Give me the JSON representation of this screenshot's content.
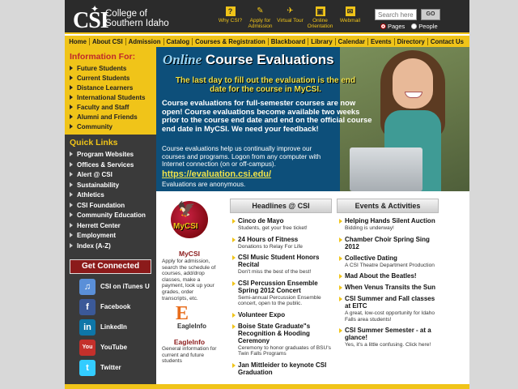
{
  "header": {
    "logo_text": "CSI",
    "college_name_line1": "College of",
    "college_name_line2": "Southern Idaho",
    "toolbar": [
      {
        "icon": "question-icon",
        "glyph": "?",
        "label": "Why CSI?"
      },
      {
        "icon": "pencil-icon",
        "glyph": "✎",
        "label": "Apply for Admission"
      },
      {
        "icon": "eagle-icon",
        "glyph": "✈",
        "label": "Virtual Tour"
      },
      {
        "icon": "monitor-icon",
        "glyph": "▣",
        "label": "Online Orientation"
      },
      {
        "icon": "mail-icon",
        "glyph": "✉",
        "label": "Webmail"
      }
    ],
    "search_placeholder": "Search here",
    "go_label": "GO",
    "radio_pages": "Pages",
    "radio_people": "People"
  },
  "nav": [
    "Home",
    "About CSI",
    "Admission",
    "Catalog",
    "Courses & Registration",
    "Blackboard",
    "Library",
    "Calendar",
    "Events",
    "Directory",
    "Contact Us"
  ],
  "info": {
    "title": "Information For:",
    "items": [
      "Future Students",
      "Current Students",
      "Distance Learners",
      "International Students",
      "Faculty and Staff",
      "Alumni and Friends",
      "Community"
    ]
  },
  "quick": {
    "title": "Quick Links",
    "items": [
      "Program Websites",
      "Offices & Services",
      "Alert @ CSI",
      "Sustainability",
      "Athletics",
      "CSI Foundation",
      "Community Education",
      "Herrett Center",
      "Employment",
      "Index (A-Z)"
    ]
  },
  "connect": {
    "title": "Get Connected",
    "items": [
      {
        "icon": "itunes-icon",
        "glyph": "♫",
        "color": "#5a8fd8",
        "label": "CSI on iTunes U"
      },
      {
        "icon": "facebook-icon",
        "glyph": "f",
        "color": "#3b5998",
        "label": "Facebook"
      },
      {
        "icon": "linkedin-icon",
        "glyph": "in",
        "color": "#0e76a8",
        "label": "LinkedIn"
      },
      {
        "icon": "youtube-icon",
        "glyph": "You",
        "color": "#c4302b",
        "label": "YouTube"
      },
      {
        "icon": "twitter-icon",
        "glyph": "t",
        "color": "#33ccff",
        "label": "Twitter"
      }
    ]
  },
  "banner": {
    "title_italic": "Online",
    "title_rest": "Course Evaluations",
    "subtitle": "The last day to fill out the evaluation is the end date for the course in MyCSI.",
    "body": "Course evaluations for full-semester courses are now open! Course evaluations become available two weeks prior to the course end date and end on the official course end date in MyCSI. We need your feedback!",
    "small": "Course evaluations help us continually improve our courses and programs. Logon from any computer with Internet connection (on or off-campus).",
    "url": "https://evaluation.csi.edu/",
    "anon": "Evaluations are anonymous."
  },
  "apps": {
    "mycsi_logo_text": "MyCSI",
    "mycsi_name": "MyCSI",
    "mycsi_desc": "Apply for admission, search the schedule of courses, add/drop classes, make a payment, look up your grades, order transcripts, etc.",
    "eagle_logo_e": "E",
    "eagle_logo_word": "EagleInfo",
    "eagle_name": "EagleInfo",
    "eagle_desc": "General information for current and future students"
  },
  "headlines": {
    "title": "Headlines @ CSI",
    "items": [
      {
        "title": "Cinco de Mayo",
        "desc": "Students, get your free ticket!"
      },
      {
        "title": "24 Hours of Fitness",
        "desc": "Donations to Relay For Life"
      },
      {
        "title": "CSI Music Student Honors Recital",
        "desc": "Don't miss the best of the best!"
      },
      {
        "title": "CSI Percussion Ensemble Spring 2012 Concert",
        "desc": "Semi-annual Percussion Ensemble concert, open to the public."
      },
      {
        "title": "Volunteer Expo",
        "desc": ""
      },
      {
        "title": "Boise State Graduate\"s Recognition & Hooding Ceremony",
        "desc": "Ceremony to honor graduates of BSU's Twin Falls Programs"
      },
      {
        "title": "Jan Mittleider to keynote CSI Graduation",
        "desc": ""
      }
    ]
  },
  "events": {
    "title": "Events & Activities",
    "items": [
      {
        "title": "Helping Hands Silent Auction",
        "desc": "Bidding is underway!"
      },
      {
        "title": "Chamber Choir Spring Sing 2012",
        "desc": ""
      },
      {
        "title": "Collective Dating",
        "desc": "A CSI Theatre Department Production"
      },
      {
        "title": "Mad About the Beatles!",
        "desc": ""
      },
      {
        "title": "When Venus Transits the Sun",
        "desc": ""
      },
      {
        "title": "CSI Summer and Fall classes at EITC",
        "desc": "A great, low-cost opportunity for Idaho Falls area students!"
      },
      {
        "title": "CSI Summer Semester - at a glance!",
        "desc": "Yes, it's a little confusing. Click here!"
      }
    ]
  }
}
